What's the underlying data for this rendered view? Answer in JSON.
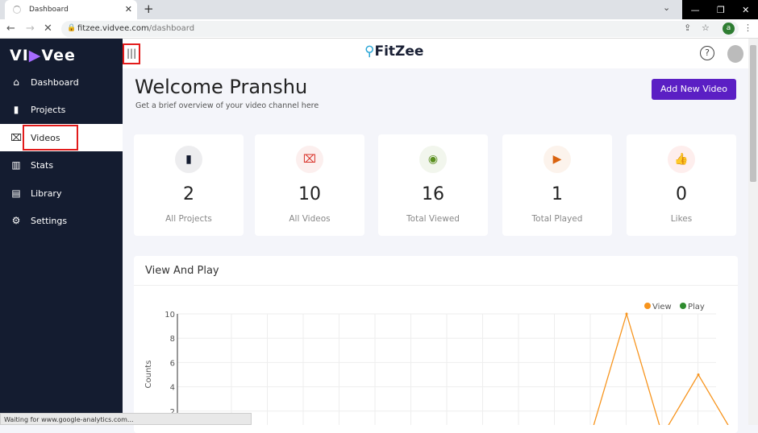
{
  "browser": {
    "tab_title": "Dashboard",
    "url_host": "fitzee.vidvee.com",
    "url_path": "/dashboard",
    "profile_initial": "a",
    "status_text": "Waiting for www.google-analytics.com..."
  },
  "sidebar": {
    "logo": "VIDVee",
    "items": [
      {
        "label": "Dashboard",
        "icon": "home-icon"
      },
      {
        "label": "Projects",
        "icon": "documents-icon"
      },
      {
        "label": "Videos",
        "icon": "film-icon"
      },
      {
        "label": "Stats",
        "icon": "bar-chart-icon"
      },
      {
        "label": "Library",
        "icon": "library-icon"
      },
      {
        "label": "Settings",
        "icon": "gear-icon"
      }
    ],
    "active": "Videos"
  },
  "header": {
    "brand": "FitZee"
  },
  "page": {
    "title": "Welcome Pranshu",
    "subtitle": "Get a brief overview of your video channel here",
    "add_button": "Add New Video"
  },
  "stats": [
    {
      "value": "2",
      "label": "All Projects",
      "icon": "documents-icon",
      "color": "#141c30"
    },
    {
      "value": "10",
      "label": "All Videos",
      "icon": "film-icon",
      "color": "#d9342b"
    },
    {
      "value": "16",
      "label": "Total Viewed",
      "icon": "eye-icon",
      "color": "#5a8f1f"
    },
    {
      "value": "1",
      "label": "Total Played",
      "icon": "play-icon",
      "color": "#d9630f"
    },
    {
      "value": "0",
      "label": "Likes",
      "icon": "thumbs-up-icon",
      "color": "#f0261b"
    }
  ],
  "chart_data": {
    "type": "line",
    "title": "View And Play",
    "ylabel": "Counts",
    "ylim": [
      0,
      10
    ],
    "yticks": [
      "2",
      "4",
      "6",
      "8",
      "10"
    ],
    "grid": true,
    "legend": "top-right",
    "series": [
      {
        "name": "View",
        "color": "#f7941d",
        "values": [
          0,
          0,
          0,
          0,
          0,
          0,
          0,
          0,
          0,
          0,
          0,
          0,
          10,
          0,
          5,
          0
        ]
      },
      {
        "name": "Play",
        "color": "#2e8b2e",
        "values": [
          0,
          0,
          0,
          0,
          0,
          0,
          0,
          0,
          0,
          0,
          0,
          0,
          0,
          0,
          0,
          0
        ]
      }
    ]
  }
}
